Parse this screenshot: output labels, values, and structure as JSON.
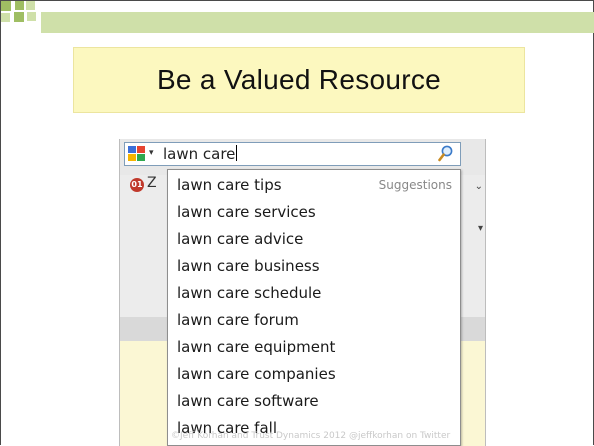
{
  "slide": {
    "title": "Be a Valued Resource",
    "footer": "©Jeff Korhan and Trust Dynamics 2012    @jeffkorhan on Twitter"
  },
  "searchbar": {
    "query": "lawn care",
    "engine_icon": "google-icon",
    "search_icon": "magnifier-icon"
  },
  "suggestions": {
    "header": "Suggestions",
    "items": [
      "lawn care tips",
      "lawn care services",
      "lawn care advice",
      "lawn care business",
      "lawn care schedule",
      "lawn care forum",
      "lawn care equipment",
      "lawn care companies",
      "lawn care software",
      "lawn care fall"
    ]
  },
  "toolbar": {
    "badge": "01",
    "letter": "Z"
  },
  "colors": {
    "band": "#cfe0a9",
    "accent": "#9fbe63",
    "title_bg": "#fcf8bf"
  }
}
